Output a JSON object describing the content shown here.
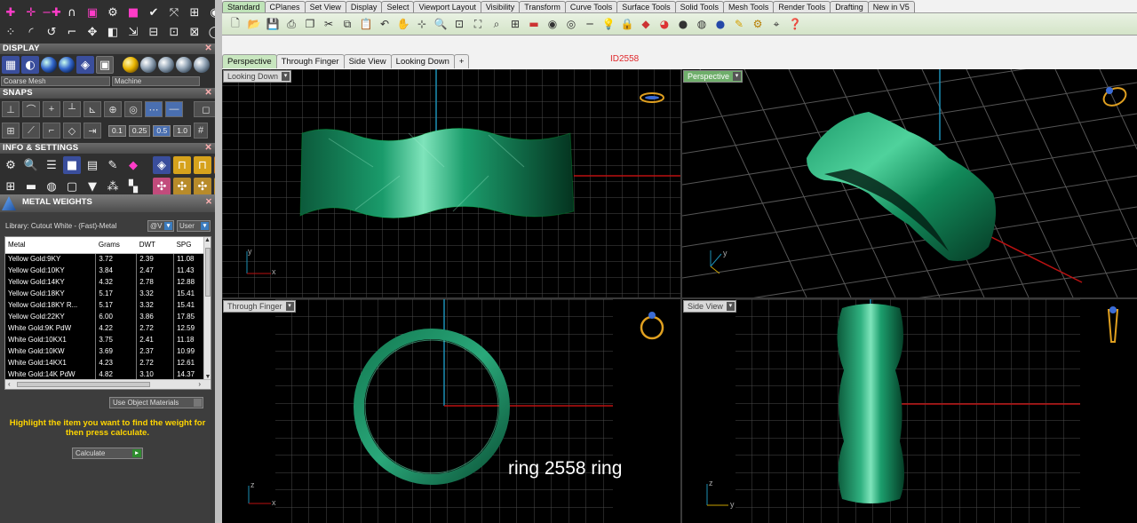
{
  "panel": {
    "display_header": "DISPLAY",
    "mesh_select": "Coarse Mesh",
    "render_select": "Machine",
    "snaps_header": "SNAPS",
    "snap_values": [
      "0.1",
      "0.25",
      "0.5",
      "1.0"
    ],
    "info_header": "INFO & SETTINGS",
    "close_glyph": "✕"
  },
  "metal_weights": {
    "title": "METAL WEIGHTS",
    "library": "Library: Cutout White - (Fast)-Metal",
    "library_btn": "@V",
    "user_btn": "User",
    "columns": [
      "Metal",
      "Grams",
      "DWT",
      "SPG"
    ],
    "rows": [
      [
        "Yellow Gold:9KY",
        "3.72",
        "2.39",
        "11.08"
      ],
      [
        "Yellow Gold:10KY",
        "3.84",
        "2.47",
        "11.43"
      ],
      [
        "Yellow Gold:14KY",
        "4.32",
        "2.78",
        "12.88"
      ],
      [
        "Yellow Gold:18KY",
        "5.17",
        "3.32",
        "15.41"
      ],
      [
        "Yellow Gold:18KY R...",
        "5.17",
        "3.32",
        "15.41"
      ],
      [
        "Yellow Gold:22KY",
        "6.00",
        "3.86",
        "17.85"
      ],
      [
        "White Gold:9K PdW",
        "4.22",
        "2.72",
        "12.59"
      ],
      [
        "White Gold:10KX1",
        "3.75",
        "2.41",
        "11.18"
      ],
      [
        "White Gold:10KW",
        "3.69",
        "2.37",
        "10.99"
      ],
      [
        "White Gold:14KX1",
        "4.23",
        "2.72",
        "12.61"
      ],
      [
        "White Gold:14K PdW",
        "4.82",
        "3.10",
        "14.37"
      ]
    ],
    "use_object_materials": "Use Object Materials",
    "hint": "Highlight the item you want to find the weight for then press calculate.",
    "calculate": "Calculate"
  },
  "toolbar_tabs": [
    "Standard",
    "CPlanes",
    "Set View",
    "Display",
    "Select",
    "Viewport Layout",
    "Visibility",
    "Transform",
    "Curve Tools",
    "Surface Tools",
    "Solid Tools",
    "Mesh Tools",
    "Render Tools",
    "Drafting",
    "New in V5"
  ],
  "viewport_tabs": [
    "Perspective",
    "Through Finger",
    "Side View",
    "Looking Down",
    "+"
  ],
  "model_id": "ID2558",
  "viewports": {
    "top_left": "Looking Down",
    "top_right": "Perspective",
    "bottom_left": "Through Finger",
    "bottom_right": "Side View"
  },
  "axis_labels": {
    "x": "x",
    "y": "y",
    "z": "z"
  },
  "caption": "ring 2558 ring"
}
